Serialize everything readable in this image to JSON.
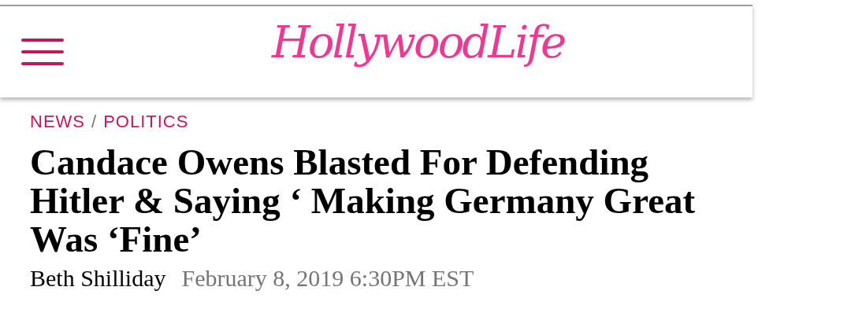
{
  "header": {
    "logo": "HollywoodLife"
  },
  "breadcrumb": [
    "NEWS",
    "POLITICS"
  ],
  "breadcrumb_separator": "/",
  "headline": "Candace Owens Blasted For Defending Hitler & Saying ‘ Making Germany Great Was ‘Fine’",
  "byline": {
    "author": "Beth Shilliday",
    "date": "February 8, 2019 6:30PM EST"
  }
}
